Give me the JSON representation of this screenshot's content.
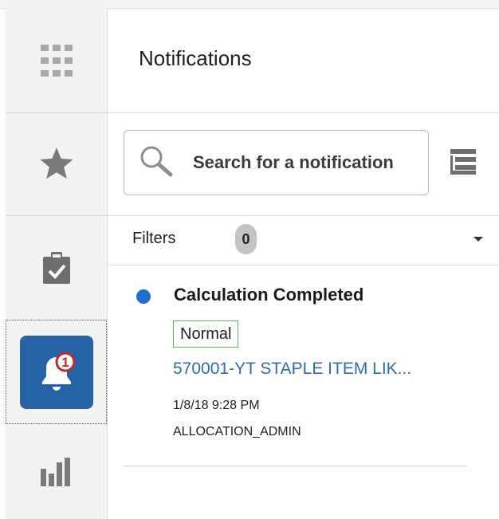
{
  "rail": {
    "items": [
      {
        "icon": "apps-grid-icon"
      },
      {
        "icon": "star-icon"
      },
      {
        "icon": "task-clipboard-icon"
      },
      {
        "icon": "bell-icon",
        "badge": "1",
        "active": true
      },
      {
        "icon": "bar-chart-icon"
      }
    ],
    "accent": "#2563a6"
  },
  "panel": {
    "title": "Notifications",
    "search": {
      "placeholder": "Search for a notification"
    },
    "filters": {
      "label": "Filters",
      "count": "0"
    }
  },
  "notifications": [
    {
      "title": "Calculation Completed",
      "priority": "Normal",
      "link": "570001-YT STAPLE ITEM LIK...",
      "time": "1/8/18 9:28 PM",
      "user": "ALLOCATION_ADMIN",
      "unread_color": "#1d6fd1"
    }
  ]
}
